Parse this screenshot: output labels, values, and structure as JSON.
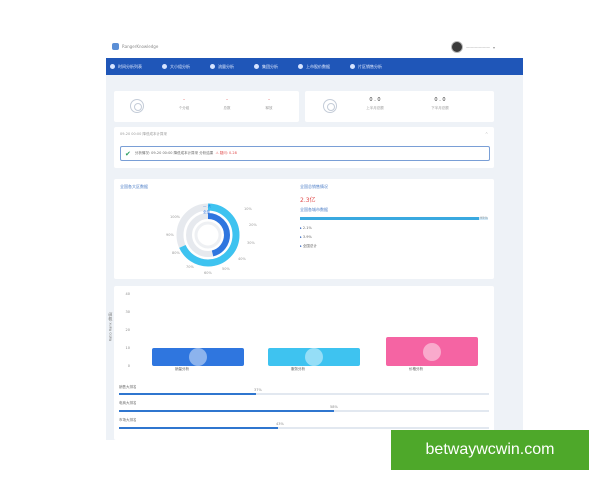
{
  "app": {
    "logo_text": "RangerKnowledge",
    "user_name": "——————",
    "nav": [
      {
        "label": "时间分析列表"
      },
      {
        "label": "大小组分析"
      },
      {
        "label": "流量分析"
      },
      {
        "label": "集团分析"
      },
      {
        "label": "上市股价数据"
      },
      {
        "label": "片区销售分析"
      }
    ]
  },
  "stats_left": {
    "items": [
      {
        "value": "-",
        "label": "个分组"
      },
      {
        "value": "-",
        "label": "总数"
      },
      {
        "value": "-",
        "label": "释放"
      }
    ]
  },
  "stats_right": {
    "items": [
      {
        "value": "0 . 0",
        "label": "上半月总额"
      },
      {
        "value": "0 . 0",
        "label": "下半月总额"
      }
    ]
  },
  "notice": {
    "header": "09-20 00:00 降低成本计算采",
    "collapse": "^",
    "check": "✔",
    "text": "分析情况: 09-20 00:00 降低成本计算采 分析结果",
    "highlight": "⚠ 疑问: 0.28"
  },
  "donut": {
    "title": "全国各大区数据",
    "center_lines": [
      "— 大",
      "全部"
    ],
    "ticks": [
      "10%",
      "20%",
      "30%",
      "40%",
      "50%",
      "60%",
      "70%",
      "80%",
      "90%",
      "100%"
    ]
  },
  "summary": {
    "title": "全国总销售情况",
    "amount": "2.3亿",
    "sub_title": "全国各城市数据",
    "progress_pct": 95,
    "progress_text": "95%",
    "legend": [
      "2.1%",
      "3.9%",
      "全国总计"
    ]
  },
  "bar_section": {
    "ylabel": "Ratio Rank (数值)",
    "y_ticks": [
      "40",
      "30",
      "20",
      "10",
      "0"
    ],
    "bars": [
      {
        "label": "销量分析",
        "color": "#2f76df"
      },
      {
        "label": "服务分析",
        "color": "#3ec3f0"
      },
      {
        "label": "价格分析",
        "color": "#f564a3"
      }
    ],
    "progress_rows": [
      {
        "label": "销售大排名",
        "pct": 37,
        "pct_text": "37%"
      },
      {
        "label": "电商大排名",
        "pct": 58,
        "pct_text": "58%"
      },
      {
        "label": "市场大排名",
        "pct": 43,
        "pct_text": "43%"
      }
    ]
  },
  "chart_data": {
    "type": "bar",
    "categories": [
      "销量分析",
      "服务分析",
      "价格分析"
    ],
    "values": [
      10,
      10,
      16
    ],
    "ylabel": "Ratio Rank (数值)",
    "ylim": [
      0,
      40
    ],
    "title": ""
  },
  "watermark": "betwaywcwin.com"
}
